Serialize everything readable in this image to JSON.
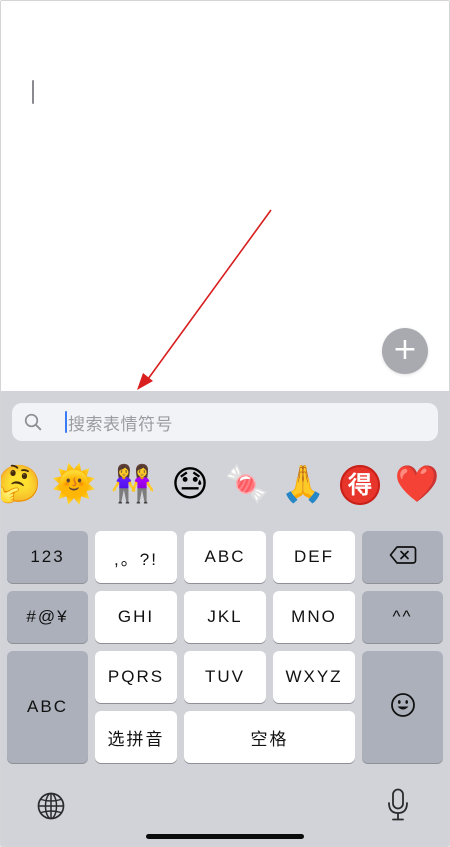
{
  "editor": {
    "add_button_icon": "plus-icon",
    "add_button_glyph": "+"
  },
  "annotation": {
    "color": "#d81e1e",
    "shape": "red-arrow"
  },
  "emoji_search": {
    "icon": "search-icon",
    "placeholder": "搜索表情符号"
  },
  "emoji_suggestions": [
    "🤔",
    "🌞",
    "👭",
    "😓",
    "🍬",
    "🙏",
    "得",
    "❤️"
  ],
  "keyboard": {
    "row1": {
      "mode_key": "123",
      "punct_key": ",。?!",
      "k2": "ABC",
      "k3": "DEF",
      "delete_icon": "backspace-icon"
    },
    "row2": {
      "symbol_key": "#@¥",
      "k4": "GHI",
      "k5": "JKL",
      "k6": "MNO",
      "face_key": "^^"
    },
    "row3": {
      "abc_key": "ABC",
      "k7": "PQRS",
      "k8": "TUV",
      "k9": "WXYZ",
      "emoji_key_icon": "smiley-icon"
    },
    "row4": {
      "pinyin_key": "选拼音",
      "space_key": "空格"
    },
    "bottom": {
      "globe_icon": "globe-icon",
      "mic_icon": "microphone-icon"
    }
  },
  "colors": {
    "keyboard_bg": "#d1d3d9",
    "dark_key": "#abb0bb",
    "light_key": "#ffffff",
    "search_caret": "#3d7bf5"
  }
}
